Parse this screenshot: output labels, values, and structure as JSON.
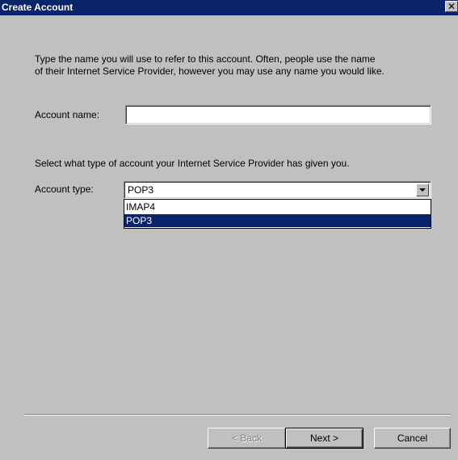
{
  "window": {
    "title": "Create Account",
    "close_symbol": "✕"
  },
  "intro": {
    "line1": "Type the name you will use to refer to this account.  Often, people use the name",
    "line2": "of their Internet Service Provider, however you may use any name you would like."
  },
  "account_name": {
    "label": "Account name:",
    "value": "",
    "placeholder": ""
  },
  "account_type": {
    "prompt": "Select what type of account your Internet Service Provider has given you.",
    "label": "Account type:",
    "selected": "POP3",
    "options": [
      {
        "label": "IMAP4",
        "selected": false
      },
      {
        "label": "POP3",
        "selected": true
      }
    ]
  },
  "buttons": {
    "back": "< Back",
    "next": "Next >",
    "cancel": "Cancel"
  },
  "colors": {
    "titlebar": "#0a246a",
    "selection": "#0a246a",
    "face": "#c0c0c0"
  }
}
